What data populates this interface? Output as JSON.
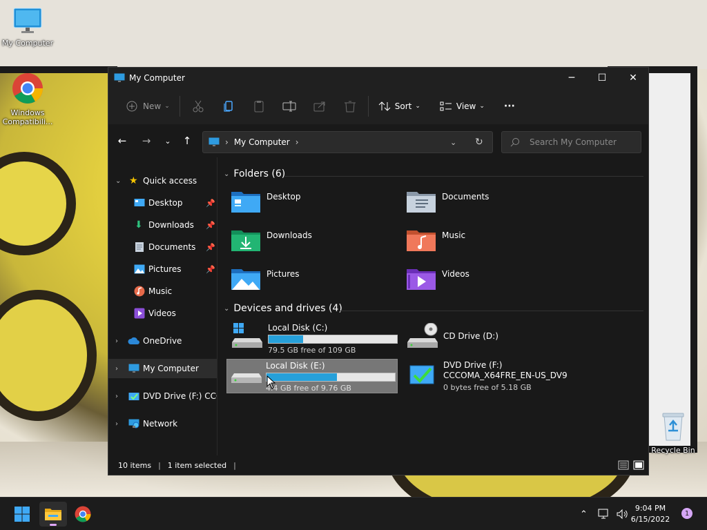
{
  "desktop": {
    "icons": [
      {
        "label": "My Computer"
      },
      {
        "label": "Windows Compatibili..."
      },
      {
        "label": "Recycle Bin"
      }
    ]
  },
  "window": {
    "title": "My Computer",
    "controls": {
      "minimize": "─",
      "maximize": "☐",
      "close": "✕"
    }
  },
  "toolbar": {
    "new_label": "New",
    "sort_label": "Sort",
    "view_label": "View",
    "more_label": "···"
  },
  "address": {
    "path": "My Computer",
    "search_placeholder": "Search My Computer"
  },
  "sidebar": {
    "items": [
      {
        "label": "Quick access"
      },
      {
        "label": "Desktop"
      },
      {
        "label": "Downloads"
      },
      {
        "label": "Documents"
      },
      {
        "label": "Pictures"
      },
      {
        "label": "Music"
      },
      {
        "label": "Videos"
      },
      {
        "label": "OneDrive"
      },
      {
        "label": "My Computer"
      },
      {
        "label": "DVD Drive (F:) CCCOMA_X64FRE_EN-US_DV9"
      },
      {
        "label": "Network"
      }
    ]
  },
  "content": {
    "folders_header": "Folders (6)",
    "folders": [
      {
        "name": "Desktop"
      },
      {
        "name": "Documents"
      },
      {
        "name": "Downloads"
      },
      {
        "name": "Music"
      },
      {
        "name": "Pictures"
      },
      {
        "name": "Videos"
      }
    ],
    "drives_header": "Devices and drives (4)",
    "drives": [
      {
        "name": "Local Disk (C:)",
        "info": "79.5 GB free of 109 GB",
        "used_fraction": 0.27
      },
      {
        "name": "CD Drive (D:)"
      },
      {
        "name": "Local Disk (E:)",
        "info": "4.4 GB free of 9.76 GB",
        "used_fraction": 0.55
      },
      {
        "name": "DVD Drive (F:)",
        "subname": "CCCOMA_X64FRE_EN-US_DV9",
        "info": "0 bytes free of 5.18 GB"
      }
    ]
  },
  "status": {
    "items": "10 items",
    "selected": "1 item selected"
  },
  "taskbar": {
    "time": "9:04 PM",
    "date": "6/15/2022",
    "notifications": "1"
  },
  "colors": {
    "accent": "#26a0da",
    "window_bg": "#191919",
    "toolbar_bg": "#202020"
  }
}
